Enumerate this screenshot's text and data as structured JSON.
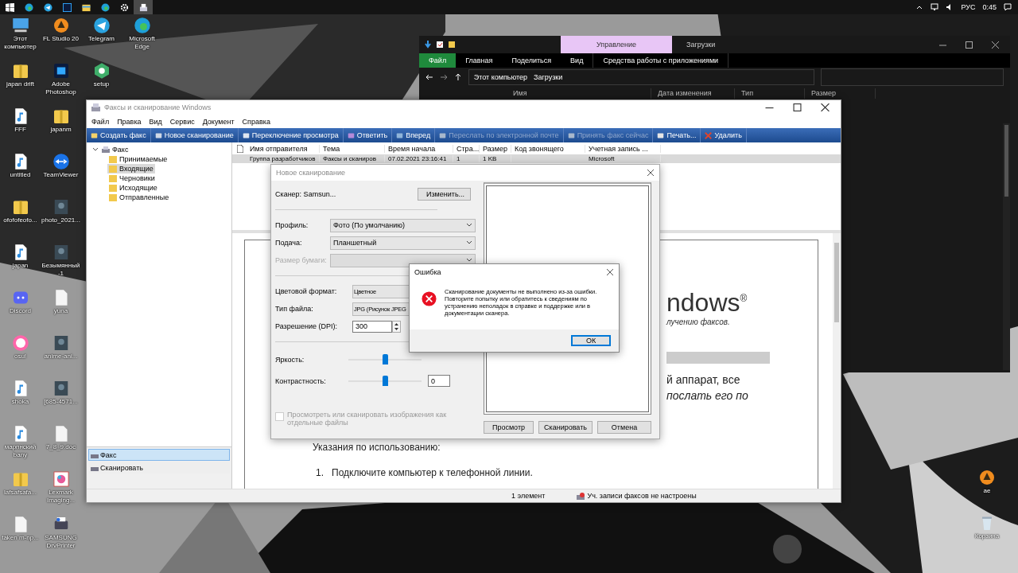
{
  "taskbar": {
    "apps": [
      {
        "kind": "start",
        "selected": false
      },
      {
        "kind": "edge",
        "selected": false
      },
      {
        "kind": "telegram",
        "selected": false
      },
      {
        "kind": "photoshop",
        "selected": false
      },
      {
        "kind": "folder",
        "selected": false
      },
      {
        "kind": "edge",
        "selected": false
      },
      {
        "kind": "gear",
        "selected": false
      },
      {
        "kind": "fax",
        "selected": true
      }
    ],
    "language": "РУС",
    "time": "0:45"
  },
  "desktop": {
    "columns": [
      [
        {
          "label": "Этот компьютер",
          "kind": "computer"
        },
        {
          "label": "japan drift",
          "kind": "zip"
        },
        {
          "label": "FFF",
          "kind": "mp3"
        },
        {
          "label": "untitled",
          "kind": "mp3"
        },
        {
          "label": "ofofofeofo...",
          "kind": "zip"
        },
        {
          "label": "japan",
          "kind": "mp3"
        },
        {
          "label": "Discord",
          "kind": "discord"
        },
        {
          "label": "osu!",
          "kind": "osu"
        },
        {
          "label": "shoka",
          "kind": "mp3"
        },
        {
          "label": "марпнский bany",
          "kind": "mp3"
        },
        {
          "label": "lafsafsafa...",
          "kind": "zip"
        },
        {
          "label": "taken m-np...",
          "kind": "doc"
        }
      ],
      [
        {
          "label": "FL Studio 20",
          "kind": "fl"
        },
        {
          "label": "Adobe Photoshop",
          "kind": "photoshop"
        },
        {
          "label": "japanm",
          "kind": "zip"
        },
        {
          "label": "TeamViewer",
          "kind": "teamviewer"
        },
        {
          "label": "photo_2021..."
        },
        {
          "label": "Безымянный-1"
        },
        {
          "label": "yuna",
          "kind": "doc"
        },
        {
          "label": "anime-ani..."
        },
        {
          "label": "[685-4571..."
        },
        {
          "label": "7_8_9.doc",
          "kind": "doc"
        },
        {
          "label": "Lexmark Imaging...",
          "kind": "app"
        },
        {
          "label": "SAMSUNG DrvPrinter",
          "kind": "printer"
        }
      ],
      [
        {
          "label": "Telegram",
          "kind": "telegram"
        },
        {
          "label": "setup",
          "kind": "setup"
        }
      ],
      [
        {
          "label": "Microsoft Edge",
          "kind": "edge"
        }
      ]
    ],
    "right_icons": [
      {
        "label": "ae",
        "kind": "fl"
      },
      {
        "label": "Корзина",
        "kind": "bin"
      }
    ]
  },
  "explorer": {
    "tab_group": "Управление",
    "title": "Загрузки",
    "ribbon_tabs": [
      {
        "label": "Файл",
        "selected": true
      },
      {
        "label": "Главная",
        "selected": false
      },
      {
        "label": "Поделиться",
        "selected": false
      },
      {
        "label": "Вид",
        "selected": false
      },
      {
        "label": "Средства работы с приложениями",
        "selected": false
      }
    ],
    "path": [
      "Этот компьютер",
      "Загрузки"
    ],
    "columns": [
      "Имя",
      "Дата изменения",
      "Тип",
      "Размер"
    ]
  },
  "fax_window": {
    "title": "Факсы и сканирование Windows",
    "menu": [
      "Файл",
      "Правка",
      "Вид",
      "Сервис",
      "Документ",
      "Справка"
    ],
    "toolbar": [
      {
        "label": "Создать факс",
        "kind": "newfax",
        "disabled": false
      },
      {
        "label": "Новое сканирование",
        "kind": "scan",
        "disabled": false
      },
      {
        "label": "Переключение просмотра",
        "kind": "view",
        "disabled": false
      },
      {
        "label": "Ответить",
        "kind": "reply",
        "disabled": false
      },
      {
        "label": "Вперед",
        "kind": "forward",
        "disabled": false
      },
      {
        "label": "Переслать по электронной почте",
        "kind": "mail",
        "disabled": true
      },
      {
        "label": "Принять факс сейчас",
        "kind": "receive",
        "disabled": true
      },
      {
        "label": "Печать...",
        "kind": "print",
        "disabled": false
      },
      {
        "label": "Удалить",
        "kind": "delete",
        "disabled": false
      }
    ],
    "tree": {
      "label": "Факс",
      "expanded": true,
      "children": [
        {
          "label": "Принимаемые",
          "selected": false
        },
        {
          "label": "Входящие",
          "selected": true
        },
        {
          "label": "Черновики",
          "selected": false
        },
        {
          "label": "Исходящие",
          "selected": false
        },
        {
          "label": "Отправленные",
          "selected": false
        }
      ]
    },
    "nav": [
      {
        "label": "Факс",
        "selected": true
      },
      {
        "label": "Сканировать",
        "selected": false
      }
    ],
    "list": {
      "columns": [
        "Имя отправителя",
        "Тема",
        "Время начала",
        "Стра...",
        "Размер",
        "Код звонящего",
        "Учетная запись ..."
      ],
      "rows": [
        {
          "cells": [
            "Группа разработчиков",
            "Факсы и сканиров",
            "07.02.2021 23:16:41",
            "1",
            "1 KB",
            "",
            "Microsoft"
          ],
          "selected": true
        }
      ]
    },
    "preview": {
      "logo": "ndows",
      "logo_mark": "®",
      "subtitle": "лучению факсов.",
      "line_1": "й аппарат, все",
      "line_2": "послать его по",
      "heading": "Указания по использованию:",
      "steps": [
        {
          "number": "1.",
          "text": "Подключите компьютер к телефонной линии."
        }
      ]
    },
    "status": [
      "1 элемент",
      "Уч. записи факсов не настроены"
    ]
  },
  "scan_dialog": {
    "title": "Новое сканирование",
    "scanner": "Сканер: Samsun...",
    "change_button": "Изменить...",
    "fields": [
      {
        "label": "Профиль:",
        "value": "Фото (По умолчанию)",
        "disabled": false
      },
      {
        "label": "Подача:",
        "value": "Планшетный",
        "disabled": false
      },
      {
        "label": "Размер бумаги:",
        "disabled": true
      }
    ],
    "format_fields": [
      {
        "label": "Цветовой формат:",
        "value": "Цветное"
      },
      {
        "label": "Тип файла:",
        "value": "JPG (Рисунок JPEG"
      }
    ],
    "dpi": {
      "label": "Разрешение (DPI):",
      "value": "300"
    },
    "sliders": [
      {
        "label": "Яркость:",
        "level": 0.5
      },
      {
        "label": "Контрастность:",
        "level": 0.5,
        "value": "0"
      }
    ],
    "separate_files": {
      "label": "Просмотреть или сканировать изображения как отдельные файлы",
      "checked": false,
      "disabled": true
    },
    "buttons": [
      "Просмотр",
      "Сканировать",
      "Отмена"
    ]
  },
  "error_dialog": {
    "title": "Ошибка",
    "message": "Сканирование документы не выполнено из-за ошибки. Повторите попытку или обратитесь к сведениям по устранению неполадок в справке и поддержке или в документации сканера.",
    "button": "ОК"
  }
}
